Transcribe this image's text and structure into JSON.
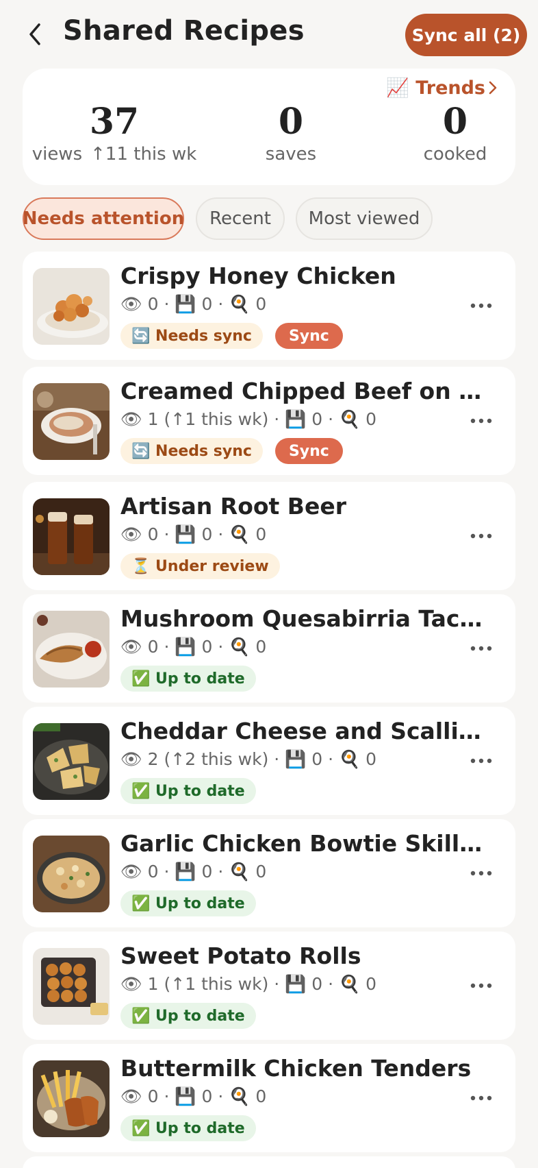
{
  "header": {
    "title": "Shared Recipes",
    "sync_all_label": "Sync all (2)"
  },
  "stats": {
    "trends_label": "📈 Trends",
    "views_value": "37",
    "views_label": "views",
    "views_trend": "↑11 this wk",
    "saves_value": "0",
    "saves_label": "saves",
    "cooked_value": "0",
    "cooked_label": "cooked"
  },
  "tabs": [
    {
      "label": "Needs attention",
      "active": true
    },
    {
      "label": "Recent",
      "active": false
    },
    {
      "label": "Most viewed",
      "active": false
    }
  ],
  "recipes": [
    {
      "title": "Crispy Honey Chicken",
      "stats": "👁 0 · 💾 0 · 🍳 0",
      "status": "🔄 Needs sync",
      "action": "Sync"
    },
    {
      "title": "Creamed Chipped Beef on T…",
      "stats": "👁 1 (↑1 this wk) · 💾 0 · 🍳 0",
      "status": "🔄 Needs sync",
      "action": "Sync"
    },
    {
      "title": "Artisan Root Beer",
      "stats": "👁 0 · 💾 0 · 🍳 0",
      "status": "⏳ Under review"
    },
    {
      "title": "Mushroom Quesabirria Tacos",
      "stats": "👁 0 · 💾 0 · 🍳 0",
      "status": "✅ Up to date"
    },
    {
      "title": "Cheddar Cheese and Scallio…",
      "stats": "👁 2 (↑2 this wk) · 💾 0 · 🍳 0",
      "status": "✅ Up to date"
    },
    {
      "title": "Garlic Chicken Bowtie Skillet…",
      "stats": "👁 0 · 💾 0 · 🍳 0",
      "status": "✅ Up to date"
    },
    {
      "title": "Sweet Potato Rolls",
      "stats": "👁 1 (↑1 this wk) · 💾 0 · 🍳 0",
      "status": "✅ Up to date"
    },
    {
      "title": "Buttermilk Chicken Tenders",
      "stats": "👁 0 · 💾 0 · 🍳 0",
      "status": "✅ Up to date"
    }
  ],
  "colors": {
    "accent": "#b9532b",
    "sync_button": "#dd6a4d",
    "background": "#f7f6f4"
  }
}
